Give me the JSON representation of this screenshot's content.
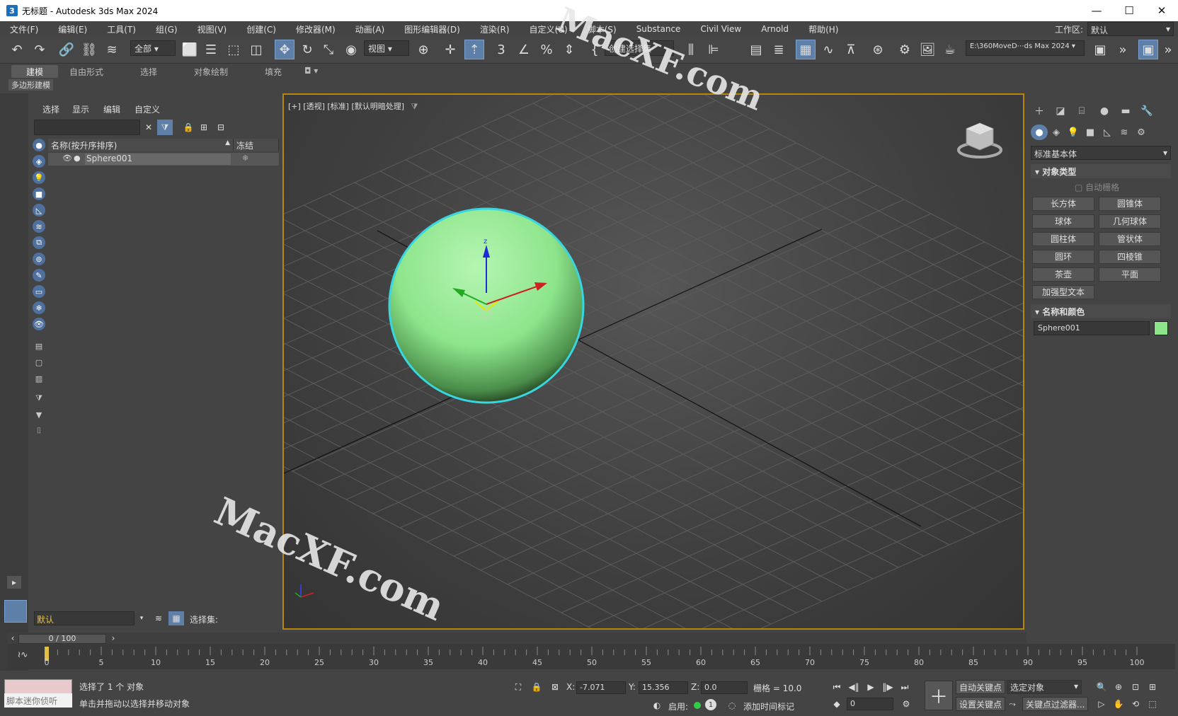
{
  "window": {
    "title": "无标题 - Autodesk 3ds Max 2024",
    "app_icon": "3",
    "min": "—",
    "max": "☐",
    "close": "✕"
  },
  "menu": [
    "文件(F)",
    "编辑(E)",
    "工具(T)",
    "组(G)",
    "视图(V)",
    "创建(C)",
    "修改器(M)",
    "动画(A)",
    "图形编辑器(D)",
    "渲染(R)",
    "自定义(U)",
    "脚本(S)",
    "Substance",
    "Civil View",
    "Arnold",
    "帮助(H)"
  ],
  "workspace": {
    "label": "工作区:",
    "value": "默认"
  },
  "toolbar": {
    "filter_value": "全部",
    "coord_value": "视图",
    "named_set": "创建选择集",
    "project_path": "E:\\360MoveD⋯ds Max 2024"
  },
  "ribbon": {
    "tabs": [
      "建模",
      "自由形式",
      "选择",
      "对象绘制",
      "填充"
    ],
    "sub_label": "多边形建模"
  },
  "scene_explorer": {
    "menus": [
      "选择",
      "显示",
      "编辑",
      "自定义"
    ],
    "col_name": "名称(按升序排序)",
    "col_frozen": "冻结",
    "rows": [
      {
        "name": "Sphere001",
        "frozen": "❄"
      }
    ],
    "layer_value": "默认",
    "selection_set_label": "选择集:"
  },
  "viewport": {
    "label": "[+] [透视] [标准] [默认明暗处理]",
    "sphere_color": "#8de58b",
    "selection_color": "#38d6e0"
  },
  "command_panel": {
    "dropdown": "标准基本体",
    "object_type_title": "对象类型",
    "autogrid": "自动栅格",
    "buttons": [
      "长方体",
      "圆锥体",
      "球体",
      "几何球体",
      "圆柱体",
      "管状体",
      "圆环",
      "四棱锥",
      "茶壶",
      "平面",
      "加强型文本"
    ],
    "name_color_title": "名称和颜色",
    "object_name": "Sphere001",
    "object_color": "#8de58b"
  },
  "timeline": {
    "frame_display": "0 / 100",
    "ticks": [
      "0",
      "5",
      "10",
      "15",
      "20",
      "25",
      "30",
      "35",
      "40",
      "45",
      "50",
      "55",
      "60",
      "65",
      "70",
      "75",
      "80",
      "85",
      "90",
      "95",
      "100"
    ]
  },
  "status": {
    "maxscript_hint": "脚本迷你侦听",
    "selected": "选择了 1 个 对象",
    "prompt": "单击并拖动以选择并移动对象",
    "x_label": "X:",
    "x_value": "-7.071",
    "y_label": "Y:",
    "y_value": "15.356",
    "z_label": "Z:",
    "z_value": "0.0",
    "grid": "栅格 = 10.0",
    "enable": "启用:",
    "add_time_tag": "添加时间标记",
    "auto_key": "自动关键点",
    "set_key": "设置关键点",
    "selected_object": "选定对象",
    "key_filters": "关键点过滤器...",
    "frame_value": "0"
  },
  "watermark": "MacXF.com"
}
